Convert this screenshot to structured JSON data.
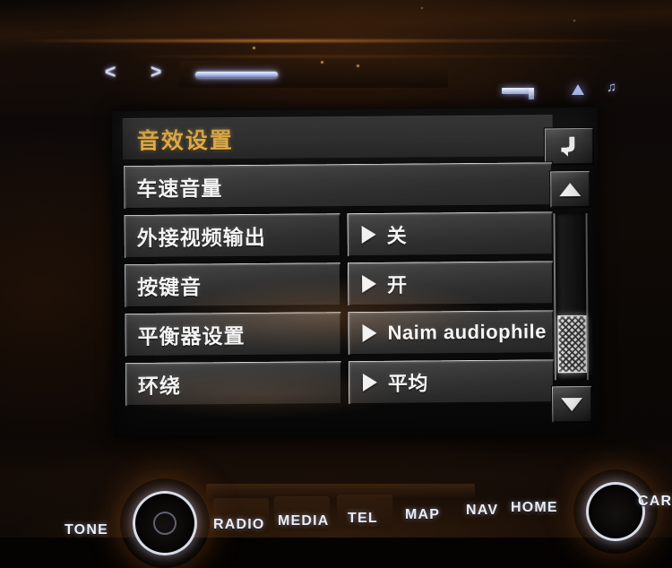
{
  "head_unit": {
    "top_controls": {
      "prev_label": "<",
      "next_label": ">",
      "cd_slot_name": "cd-slot",
      "status_icons": [
        "eject-icon",
        "triangle-icon",
        "music-note-icon"
      ]
    },
    "bottom_buttons": [
      {
        "label": "TONE"
      },
      {
        "label": "RADIO"
      },
      {
        "label": "MEDIA"
      },
      {
        "label": "TEL"
      },
      {
        "label": "MAP"
      },
      {
        "label": "NAV"
      },
      {
        "label": "HOME"
      },
      {
        "label": "CAR"
      }
    ],
    "knobs": [
      {
        "name": "volume-power-knob"
      },
      {
        "name": "menu-select-knob"
      }
    ]
  },
  "screen": {
    "title": "音效设置",
    "title_color": "#e0ab45",
    "back_button": {
      "name": "back-button",
      "icon": "back-arrow-icon"
    },
    "scroll": {
      "up_icon": "triangle-up-icon",
      "down_icon": "triangle-down-icon",
      "thumb_name": "scrollbar-thumb",
      "position_percent": 72
    },
    "rows": [
      {
        "label": "车速音量",
        "value": null,
        "has_value": false
      },
      {
        "label": "外接视频输出",
        "value": "关",
        "has_value": true
      },
      {
        "label": "按键音",
        "value": "开",
        "has_value": true
      },
      {
        "label": "平衡器设置",
        "value": "Naim audiophile",
        "has_value": true
      },
      {
        "label": "环绕",
        "value": "平均",
        "has_value": true
      }
    ]
  }
}
